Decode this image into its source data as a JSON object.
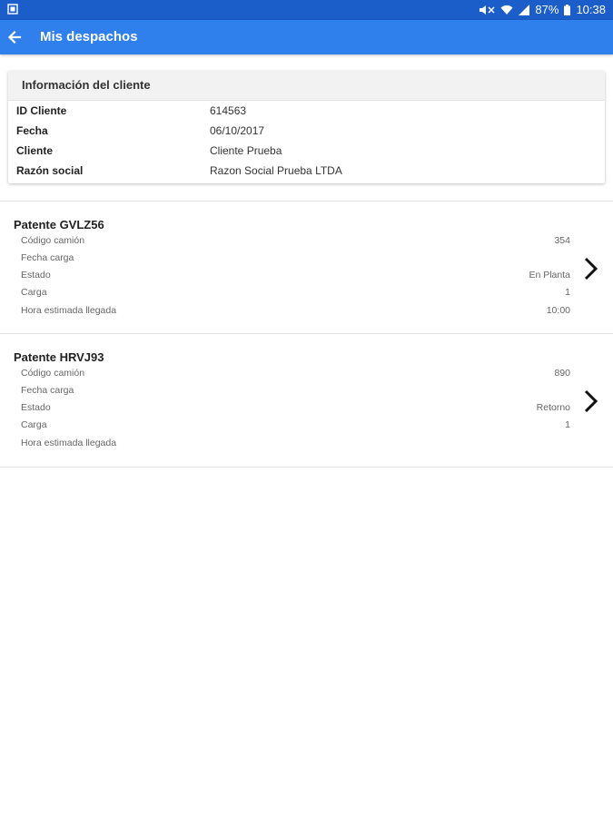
{
  "status_bar": {
    "battery": "87%",
    "time": "10:38"
  },
  "app_bar": {
    "title": "Mis despachos"
  },
  "client_info": {
    "header": "Información del cliente",
    "rows": [
      {
        "label": "ID Cliente",
        "value": "614563"
      },
      {
        "label": "Fecha",
        "value": "06/10/2017"
      },
      {
        "label": "Cliente",
        "value": "Cliente Prueba"
      },
      {
        "label": "Razón social",
        "value": "Razon Social Prueba LTDA"
      }
    ]
  },
  "dispatches": [
    {
      "patente": "Patente GVLZ56",
      "fields": [
        {
          "label": "Código camión",
          "value": "354"
        },
        {
          "label": "Fecha carga",
          "value": ""
        },
        {
          "label": "Estado",
          "value": "En Planta"
        },
        {
          "label": "Carga",
          "value": "1"
        },
        {
          "label": "Hora estimada llegada",
          "value": "10:00"
        }
      ]
    },
    {
      "patente": "Patente HRVJ93",
      "fields": [
        {
          "label": "Código camión",
          "value": "890"
        },
        {
          "label": "Fecha carga",
          "value": ""
        },
        {
          "label": "Estado",
          "value": "Retorno"
        },
        {
          "label": "Carga",
          "value": "1"
        },
        {
          "label": "Hora estimada llegada",
          "value": ""
        }
      ]
    }
  ],
  "icons": {
    "back": "arrow-left-icon",
    "chevron": "chevron-right-icon",
    "app_bar_color": "#2f80ed",
    "status_bar_color": "#1b5dc9"
  }
}
